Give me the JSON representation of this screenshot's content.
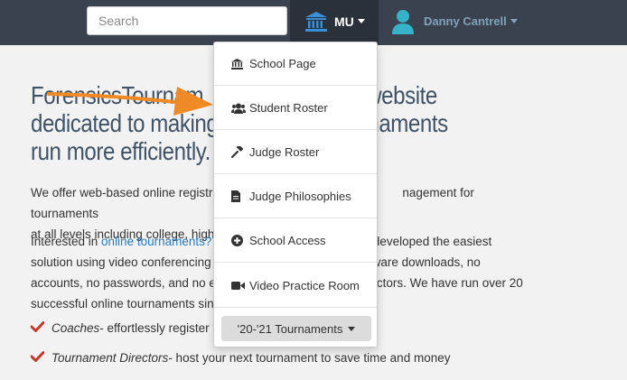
{
  "header": {
    "search_placeholder": "Search",
    "school_abbr": "MU",
    "user_name": "Danny Cantrell"
  },
  "hero": {
    "line1_a": "ForensicsTournam",
    "line1_b": "ured website",
    "line2_a": "dedicated to making",
    "line2_b": "te tournaments",
    "line3": "run more efficiently."
  },
  "body": {
    "p1_a": "We offer web-based online registr",
    "p1_b": "nagement for tournaments",
    "p1_c": "at all levels including college, high",
    "p2_a": "Interested in ",
    "p2_link": "online tournaments?",
    "p2_b": "s developed the easiest",
    "p2_c": "solution using video conferencing",
    "p2_d": "ware downloads, no",
    "p2_e": "accounts, no passwords, and no e",
    "p2_f": "ctors. We have run over 20",
    "p2_g": "successful online tournaments sin",
    "c1_role": "Coaches",
    "c1_text": " - effortlessly register t",
    "c2_role": "Tournament Directors",
    "c2_text": " - host your next tournament to save time and money"
  },
  "menu": {
    "items": [
      {
        "label": "School Page",
        "icon": "bank-icon"
      },
      {
        "label": "Student Roster",
        "icon": "users-icon"
      },
      {
        "label": "Judge Roster",
        "icon": "gavel-icon"
      },
      {
        "label": "Judge Philosophies",
        "icon": "file-icon"
      },
      {
        "label": "School Access",
        "icon": "plus-circle-icon"
      },
      {
        "label": "Video Practice Room",
        "icon": "video-icon"
      }
    ],
    "season_selector": "'20-'21 Tournaments"
  },
  "colors": {
    "topbar": "#3a4250",
    "accent_link": "#2b7bb9",
    "arrow": "#f08a24",
    "check": "#c0392b"
  }
}
